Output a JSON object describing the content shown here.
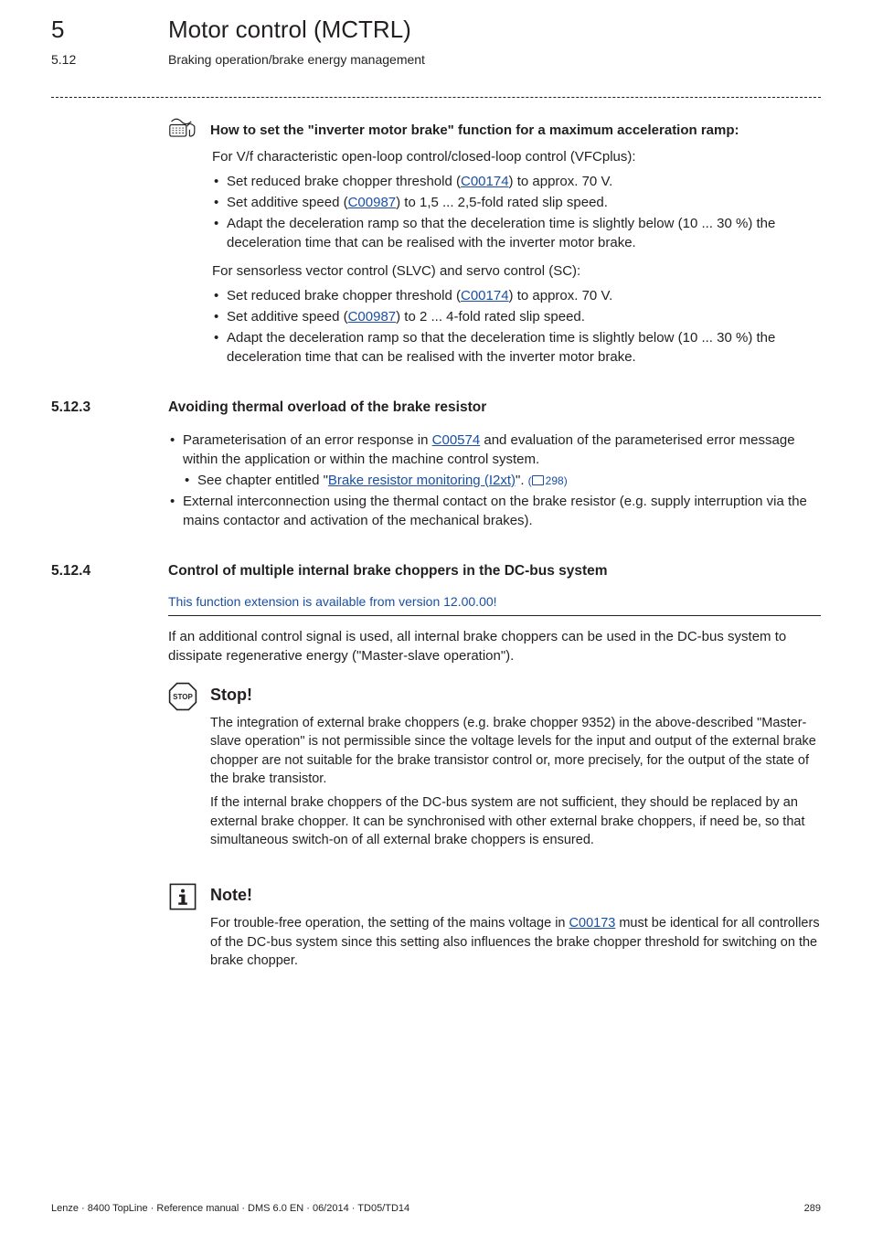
{
  "header": {
    "chapter_num": "5",
    "chapter_title": "Motor control (MCTRL)",
    "section_num": "5.12",
    "section_title": "Braking operation/brake energy management"
  },
  "howto": {
    "title": "How to set the \"inverter motor brake\" function for a maximum acceleration ramp:",
    "group1_intro": "For V/f characteristic open-loop control/closed-loop control (VFCplus):",
    "group1_b1_pre": "Set reduced brake chopper threshold (",
    "group1_b1_link": "C00174",
    "group1_b1_post": ") to approx. 70 V.",
    "group1_b2_pre": "Set additive speed (",
    "group1_b2_link": "C00987",
    "group1_b2_post": ") to 1,5 ... 2,5-fold rated slip speed.",
    "group1_b3": "Adapt the deceleration ramp so that the deceleration time is slightly below (10 ... 30 %) the deceleration time that can be realised with the inverter motor brake.",
    "group2_intro": "For sensorless vector control (SLVC) and servo control (SC):",
    "group2_b1_pre": "Set reduced brake chopper threshold (",
    "group2_b1_link": "C00174",
    "group2_b1_post": ") to approx. 70 V.",
    "group2_b2_pre": "Set additive speed (",
    "group2_b2_link": "C00987",
    "group2_b2_post": ") to 2 ... 4-fold rated slip speed.",
    "group2_b3": "Adapt the deceleration ramp so that the deceleration time is slightly below (10 ... 30 %) the deceleration time that can be realised with the inverter motor brake."
  },
  "sec5123": {
    "num": "5.12.3",
    "title": "Avoiding thermal overload of the brake resistor",
    "b1_pre": "Parameterisation of an error response in ",
    "b1_link": "C00574",
    "b1_post": " and evaluation of the parameterised error message within the application or within the machine control system.",
    "b1_sub_pre": "See chapter entitled \"",
    "b1_sub_link": "Brake resistor monitoring (I2xt)",
    "b1_sub_post": "\".",
    "b1_sub_ref": "298",
    "b2": "External interconnection using the thermal contact on the brake resistor (e.g. supply interruption via the mains contactor and activation of the mechanical brakes)."
  },
  "sec5124": {
    "num": "5.12.4",
    "title": "Control of multiple internal brake choppers in the DC-bus system",
    "blue": "This function extension is available from version 12.00.00!",
    "intro": "If an additional control signal is used, all internal brake choppers can be used in the DC-bus system to dissipate regenerative energy (\"Master-slave operation\").",
    "stop_title": "Stop!",
    "stop_p1": "The integration of external brake choppers (e.g. brake chopper 9352) in the above-described \"Master-slave operation\" is not permissible since the voltage levels for the input and output of the external brake chopper are not suitable for the brake transistor control or, more precisely, for the output of the state of the brake transistor.",
    "stop_p2": "If the internal brake choppers of the DC-bus system are not sufficient, they should be replaced by an external brake chopper. It can be synchronised with other external brake choppers, if need be, so that simultaneous switch-on of all external brake choppers is ensured.",
    "note_title": "Note!",
    "note_p_pre": "For trouble-free operation, the setting of the mains voltage in ",
    "note_p_link": "C00173",
    "note_p_post": " must be identical for all controllers of the DC-bus system since this setting also influences the brake chopper threshold for switching on the brake chopper."
  },
  "footer": {
    "left": "Lenze · 8400 TopLine · Reference manual · DMS 6.0 EN · 06/2014 · TD05/TD14",
    "right": "289"
  }
}
